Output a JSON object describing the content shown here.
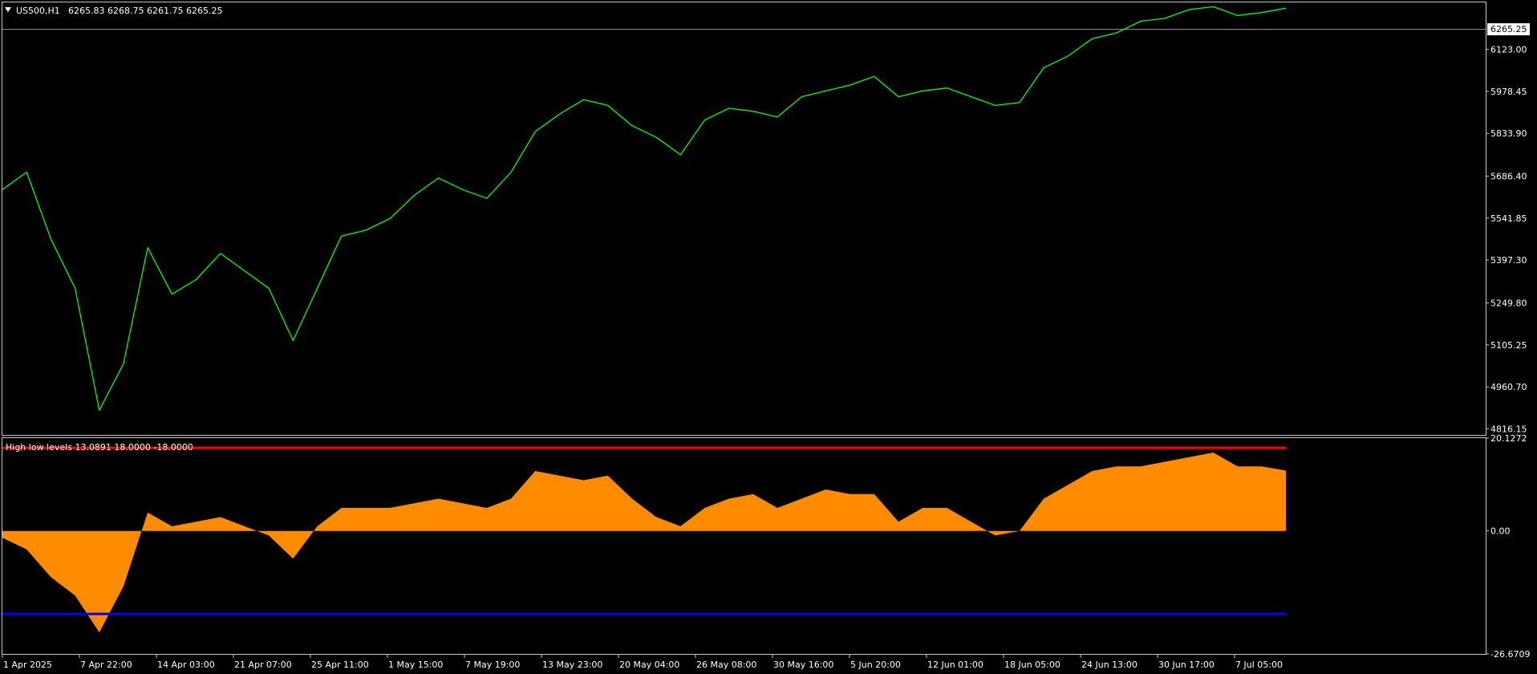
{
  "colors": {
    "background": "#000000",
    "frame": "#c8c8c8",
    "price_line": "#00ff00",
    "histogram": "#ff8c00",
    "high_level": "#ff0000",
    "low_level": "#0000ff",
    "text": "#ffffff",
    "price_tag_bg": "#ffffff",
    "price_tag_text": "#000000"
  },
  "main_panel": {
    "symbol_label": "US500,H1",
    "ohlc_label": "6265.83 6268.75 6261.75 6265.25",
    "collapse_icon": "triangle-down-icon",
    "current_price": "6265.25",
    "price_ticks": [
      "6123.00",
      "5978.45",
      "5833.90",
      "5686.40",
      "5541.85",
      "5397.30",
      "5249.80",
      "5105.25",
      "4960.70",
      "4816.15"
    ]
  },
  "indicator_panel": {
    "label": "High low levels 13.0891 18.0000 -18.0000",
    "value_ticks": [
      "20.1272",
      "0.00",
      "-26.6709"
    ]
  },
  "x_ticks": [
    "1 Apr 2025",
    "7 Apr 22:00",
    "14 Apr 03:00",
    "21 Apr 07:00",
    "25 Apr 11:00",
    "1 May 15:00",
    "7 May 19:00",
    "13 May 23:00",
    "20 May 04:00",
    "26 May 08:00",
    "30 May 16:00",
    "5 Jun 20:00",
    "12 Jun 01:00",
    "18 Jun 05:00",
    "24 Jun 13:00",
    "30 Jun 17:00",
    "7 Jul 05:00"
  ],
  "chart_data": [
    {
      "type": "line",
      "x": [
        "1 Apr 2025",
        "2 Apr",
        "3 Apr",
        "4 Apr",
        "7 Apr",
        "8 Apr",
        "9 Apr",
        "10 Apr",
        "11 Apr",
        "14 Apr",
        "16 Apr",
        "18 Apr",
        "21 Apr",
        "22 Apr",
        "24 Apr",
        "25 Apr",
        "28 Apr",
        "1 May",
        "2 May",
        "5 May",
        "7 May",
        "8 May",
        "12 May",
        "13 May",
        "16 May",
        "19 May",
        "20 May",
        "22 May",
        "23 May",
        "26 May",
        "27 May",
        "29 May",
        "30 May",
        "3 Jun",
        "5 Jun",
        "6 Jun",
        "10 Jun",
        "12 Jun",
        "13 Jun",
        "16 Jun",
        "18 Jun",
        "19 Jun",
        "20 Jun",
        "23 Jun",
        "24 Jun",
        "26 Jun",
        "27 Jun",
        "30 Jun",
        "1 Jul",
        "2 Jul",
        "3 Jul",
        "7 Jul",
        "8 Jul",
        "9 Jul"
      ],
      "y": [
        5640,
        5700,
        5470,
        5300,
        4880,
        5040,
        5440,
        5280,
        5330,
        5420,
        5360,
        5300,
        5120,
        5300,
        5480,
        5500,
        5540,
        5620,
        5680,
        5640,
        5610,
        5700,
        5840,
        5900,
        5950,
        5930,
        5860,
        5820,
        5760,
        5880,
        5920,
        5910,
        5890,
        5960,
        5980,
        6000,
        6030,
        5960,
        5980,
        5990,
        5960,
        5930,
        5940,
        6060,
        6100,
        6160,
        6180,
        6220,
        6230,
        6260,
        6270,
        6240,
        6250,
        6265
      ],
      "ylim": [
        4795,
        6285
      ]
    },
    {
      "type": "area",
      "x": [
        "1 Apr 2025",
        "2 Apr",
        "3 Apr",
        "4 Apr",
        "7 Apr",
        "8 Apr",
        "9 Apr",
        "10 Apr",
        "11 Apr",
        "14 Apr",
        "16 Apr",
        "18 Apr",
        "21 Apr",
        "22 Apr",
        "24 Apr",
        "25 Apr",
        "28 Apr",
        "1 May",
        "2 May",
        "5 May",
        "7 May",
        "8 May",
        "12 May",
        "13 May",
        "16 May",
        "19 May",
        "20 May",
        "22 May",
        "23 May",
        "26 May",
        "27 May",
        "29 May",
        "30 May",
        "3 Jun",
        "5 Jun",
        "6 Jun",
        "10 Jun",
        "12 Jun",
        "13 Jun",
        "16 Jun",
        "18 Jun",
        "19 Jun",
        "20 Jun",
        "23 Jun",
        "24 Jun",
        "26 Jun",
        "27 Jun",
        "30 Jun",
        "1 Jul",
        "2 Jul",
        "3 Jul",
        "7 Jul",
        "8 Jul",
        "9 Jul"
      ],
      "y": [
        -1.5,
        -4,
        -10,
        -14,
        -22,
        -12,
        4,
        1,
        2,
        3,
        1,
        -1,
        -6,
        1,
        5,
        5,
        5,
        6,
        7,
        6,
        5,
        7,
        13,
        12,
        11,
        12,
        7,
        3,
        1,
        5,
        7,
        8,
        5,
        7,
        9,
        8,
        8,
        2,
        5,
        5,
        2,
        -1,
        0,
        7,
        10,
        13,
        14,
        14,
        15,
        16,
        17,
        14,
        14,
        13.09
      ],
      "ylim": [
        -26.6709,
        20.1272
      ],
      "levels": [
        18,
        -18
      ]
    }
  ]
}
